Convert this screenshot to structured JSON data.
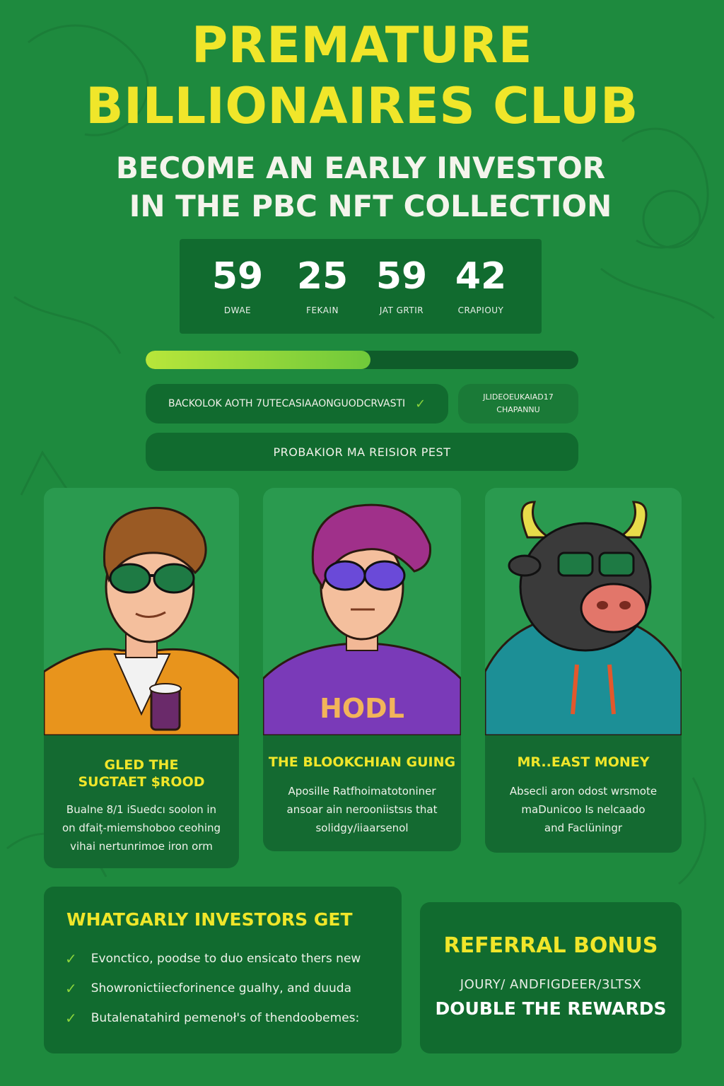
{
  "header": {
    "title_line1": "PREMATURE",
    "title_line2": "BILLIONAIRES CLUB",
    "subtitle_line1": "BECOME AN EARLY INVESTOR",
    "subtitle_line2": "IN THE PBC NFT COLLECTION"
  },
  "countdown": [
    {
      "value": "59",
      "label": "DWAE"
    },
    {
      "value": "25",
      "label": "FEKAIN"
    },
    {
      "value": "59",
      "label": "JAT GRTIR"
    },
    {
      "value": "42",
      "label": "CRAPIOUY"
    }
  ],
  "progress": {
    "fraction": 0.52
  },
  "info_pills": {
    "pill_a_text": "BACKOLOK AOTH 7UTECASIAAONGUODCRVASTI",
    "pill_b_line1": "JLIDEOEUKAIAD17",
    "pill_b_line2": "CHAPANNU",
    "pill_c_text": "PROBAKIOR MA REISIOR PEST"
  },
  "characters": [
    {
      "name_line1": "GLED THE",
      "name_line2": "SUGTAET $ROOD",
      "desc": [
        "Bualne 8/1 iSuedcı soolon in",
        "on dfaiț-miemshoboo ceohing",
        "vihai nertunrimoe iron orm"
      ]
    },
    {
      "name_line1": "THE BLOOKCHIAN GUING",
      "name_line2": "",
      "shirt_text": "HODL",
      "desc": [
        "Aposille Ratfhoimatotoniner",
        "ansoar ain nerooniistsıs that",
        "solidgy/iiaarsenol"
      ]
    },
    {
      "name_line1": "MR..EAST MONEY",
      "name_line2": "",
      "desc": [
        "Absecli aron odost wrsmote",
        "maDunicoo Is nelcaado",
        "and Faclüningr"
      ]
    }
  ],
  "benefits_panel": {
    "title": "WHATGARLY INVESTORS GET",
    "items": [
      "Evonctico, poodse to duo ensicato thers new",
      "Showronictiiecforinence gualhy, and duuda",
      "Butalenatahird pemenoł's of thendoobemes:"
    ]
  },
  "referral_panel": {
    "title": "REFERRAL BONUS",
    "subline": "JOURY/ ANDFIGDEER/3LTSX",
    "cta": "DOUBLE THE REWARDS"
  },
  "colors": {
    "background": "#1e8a3e",
    "panel": "#116b2f",
    "accent_yellow": "#f0e62a",
    "progress": "#b8e63a"
  }
}
